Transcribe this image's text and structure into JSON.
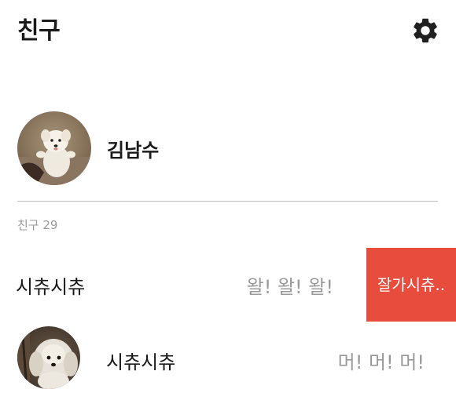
{
  "header": {
    "title": "친구",
    "settings_icon": "gear-icon"
  },
  "my_profile": {
    "name": "김남수",
    "avatar": "dog-photo"
  },
  "friends_section": {
    "label": "친구 29"
  },
  "friends": [
    {
      "name": "시츄시츄",
      "status": "왈! 왈! 왈!",
      "swipe_action_label": "잘가시츄..",
      "swipe_action_color": "#e84c3d"
    },
    {
      "name": "시츄시츄",
      "status": "머! 머! 머!",
      "avatar": "shih-tzu-photo"
    }
  ],
  "colors": {
    "text_primary": "#1a1a1a",
    "text_secondary": "#9a9a9a",
    "divider": "#bdbdbd",
    "delete_red": "#e84c3d"
  }
}
